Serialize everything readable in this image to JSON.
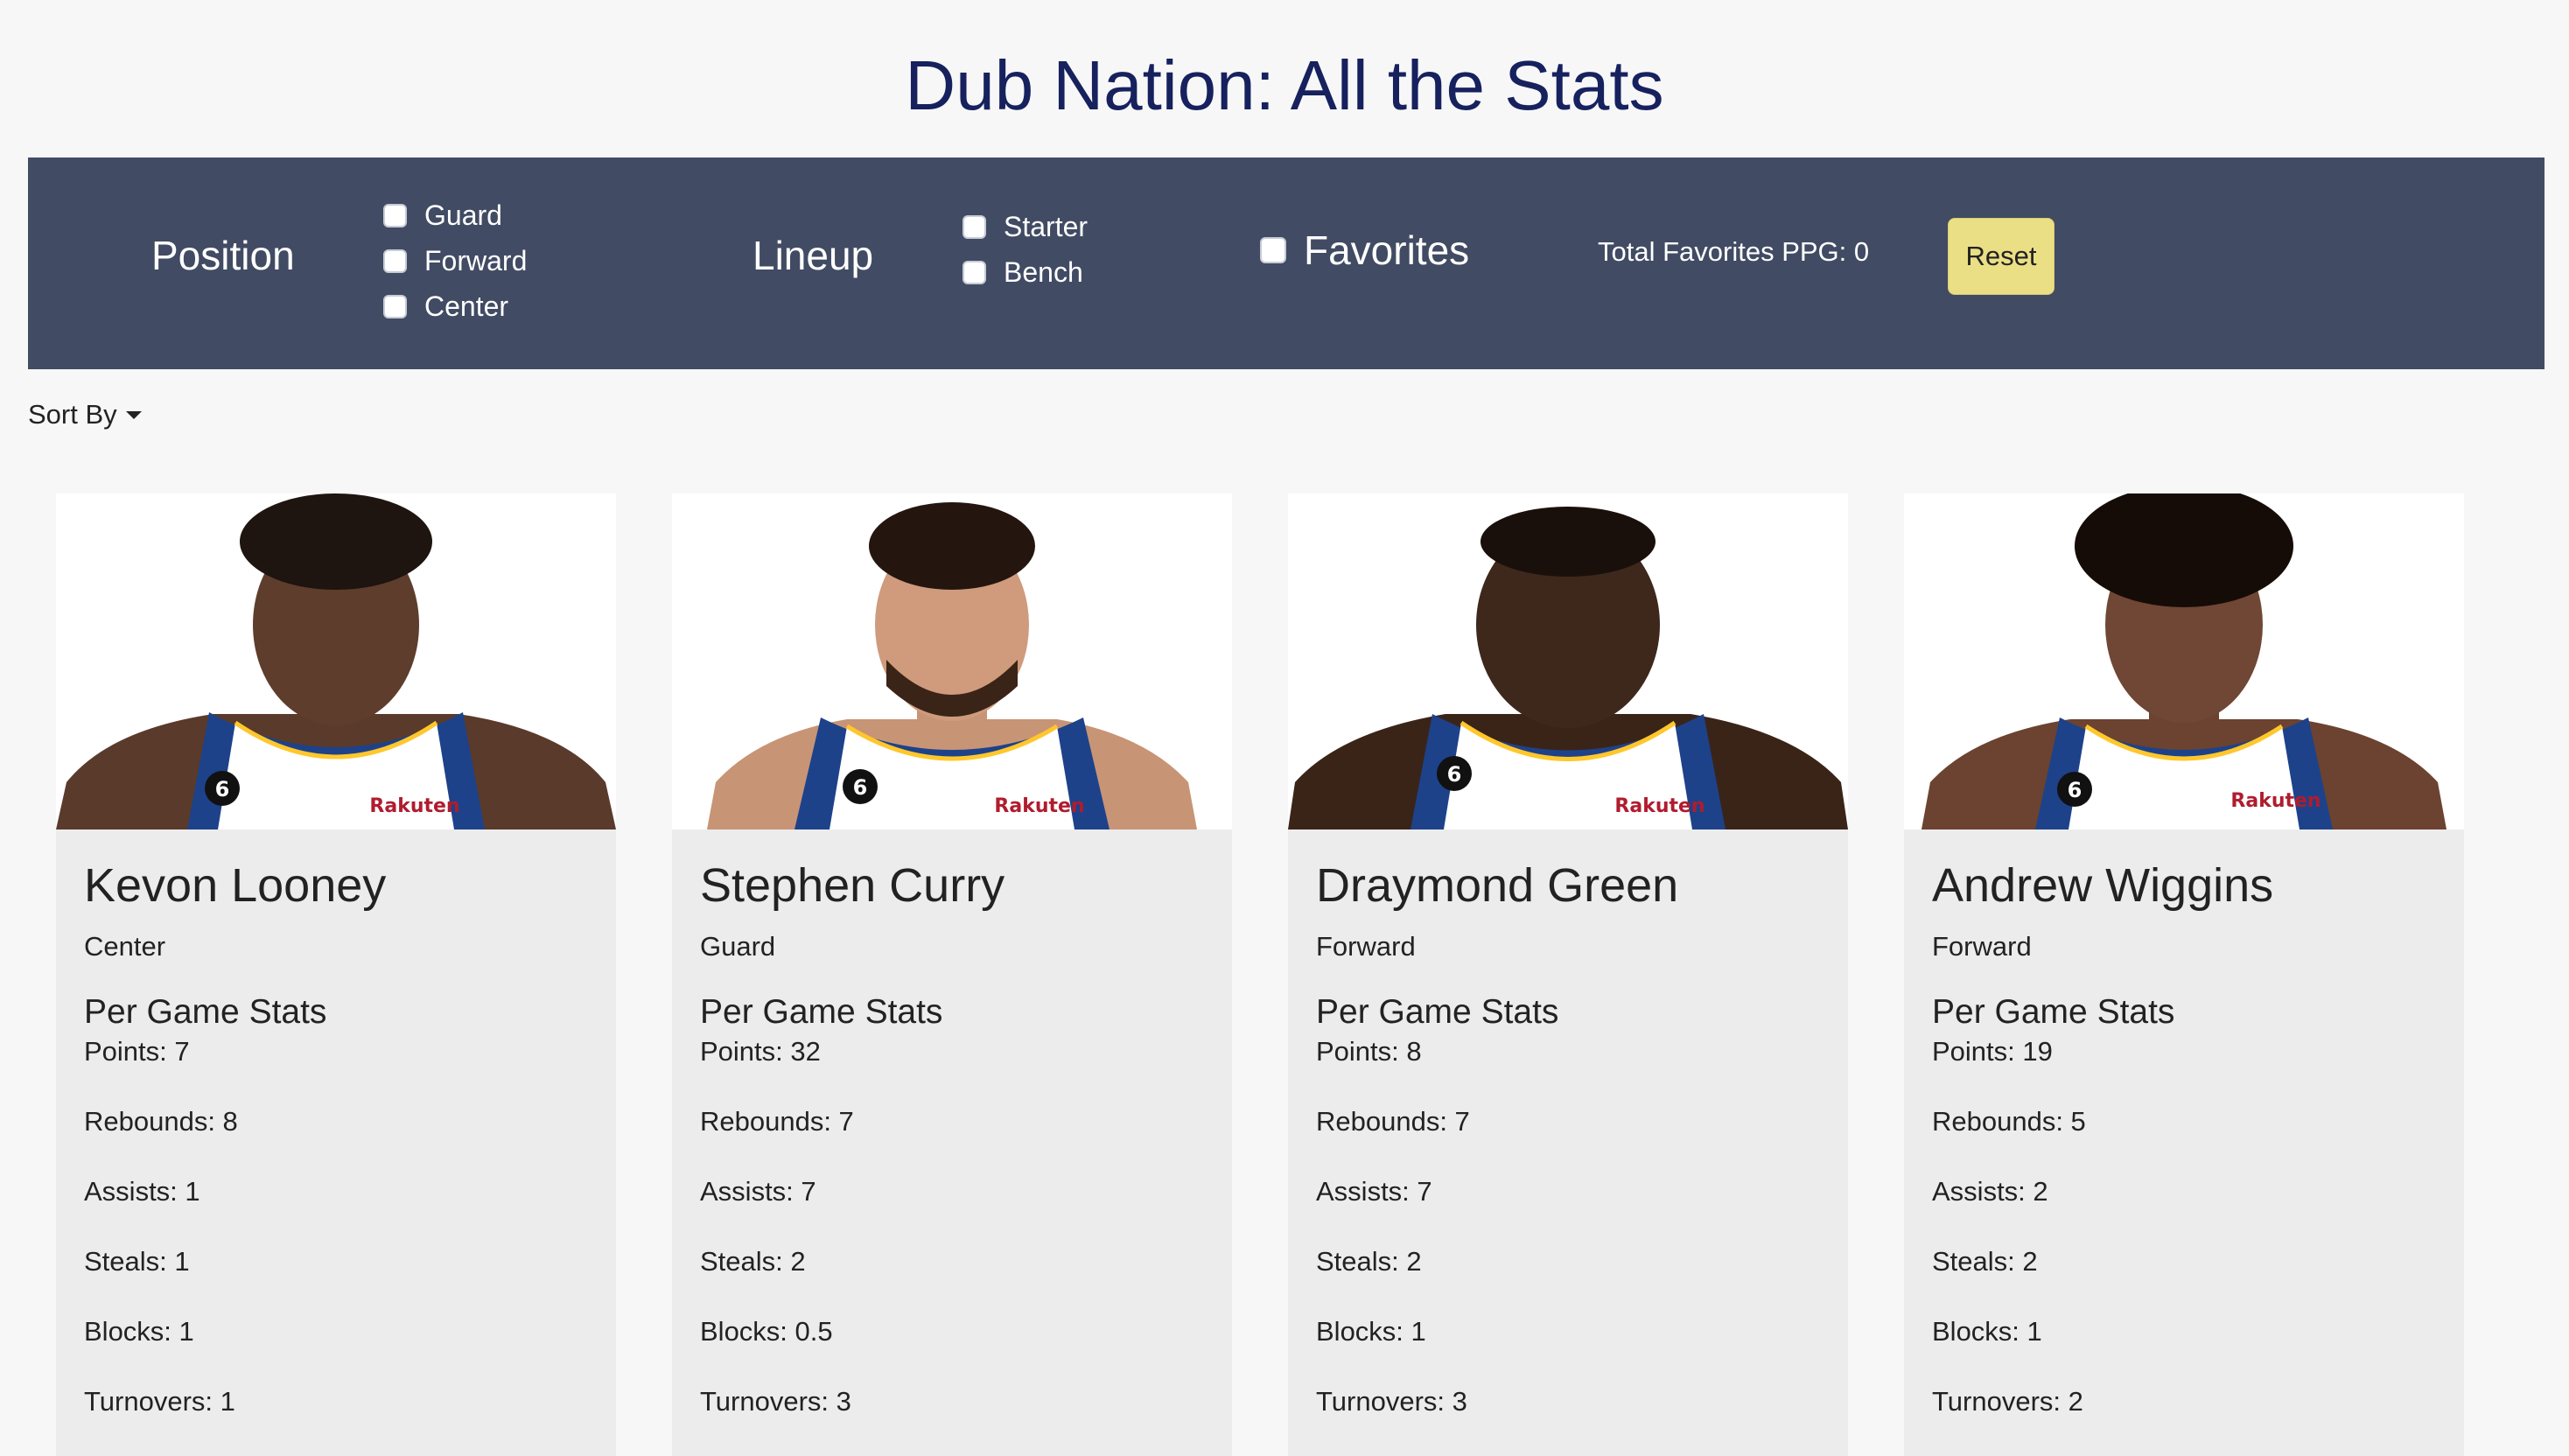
{
  "title": "Dub Nation: All the Stats",
  "filters": {
    "position_label": "Position",
    "positions": [
      "Guard",
      "Forward",
      "Center"
    ],
    "lineup_label": "Lineup",
    "lineups": [
      "Starter",
      "Bench"
    ],
    "favorites_label": "Favorites",
    "total_favorites_text": "Total Favorites PPG: 0",
    "reset_label": "Reset"
  },
  "sort": {
    "label": "Sort By"
  },
  "colors": {
    "title": "#16215e",
    "filter_bar": "#414b63",
    "reset_button": "#ebdf86",
    "card": "#ececec",
    "jersey_blue": "#1d428a",
    "jersey_gold": "#ffc72c"
  },
  "players": [
    {
      "name": "Kevon Looney",
      "position": "Center",
      "stats_heading": "Per Game Stats",
      "stats": [
        "Points: 7",
        "Rebounds: 8",
        "Assists: 1",
        "Steals: 1",
        "Blocks: 1",
        "Turnovers: 1"
      ]
    },
    {
      "name": "Stephen Curry",
      "position": "Guard",
      "stats_heading": "Per Game Stats",
      "stats": [
        "Points: 32",
        "Rebounds: 7",
        "Assists: 7",
        "Steals: 2",
        "Blocks: 0.5",
        "Turnovers: 3"
      ]
    },
    {
      "name": "Draymond Green",
      "position": "Forward",
      "stats_heading": "Per Game Stats",
      "stats": [
        "Points: 8",
        "Rebounds: 7",
        "Assists: 7",
        "Steals: 2",
        "Blocks: 1",
        "Turnovers: 3"
      ]
    },
    {
      "name": "Andrew Wiggins",
      "position": "Forward",
      "stats_heading": "Per Game Stats",
      "stats": [
        "Points: 19",
        "Rebounds: 5",
        "Assists: 2",
        "Steals: 2",
        "Blocks: 1",
        "Turnovers: 2"
      ]
    }
  ]
}
